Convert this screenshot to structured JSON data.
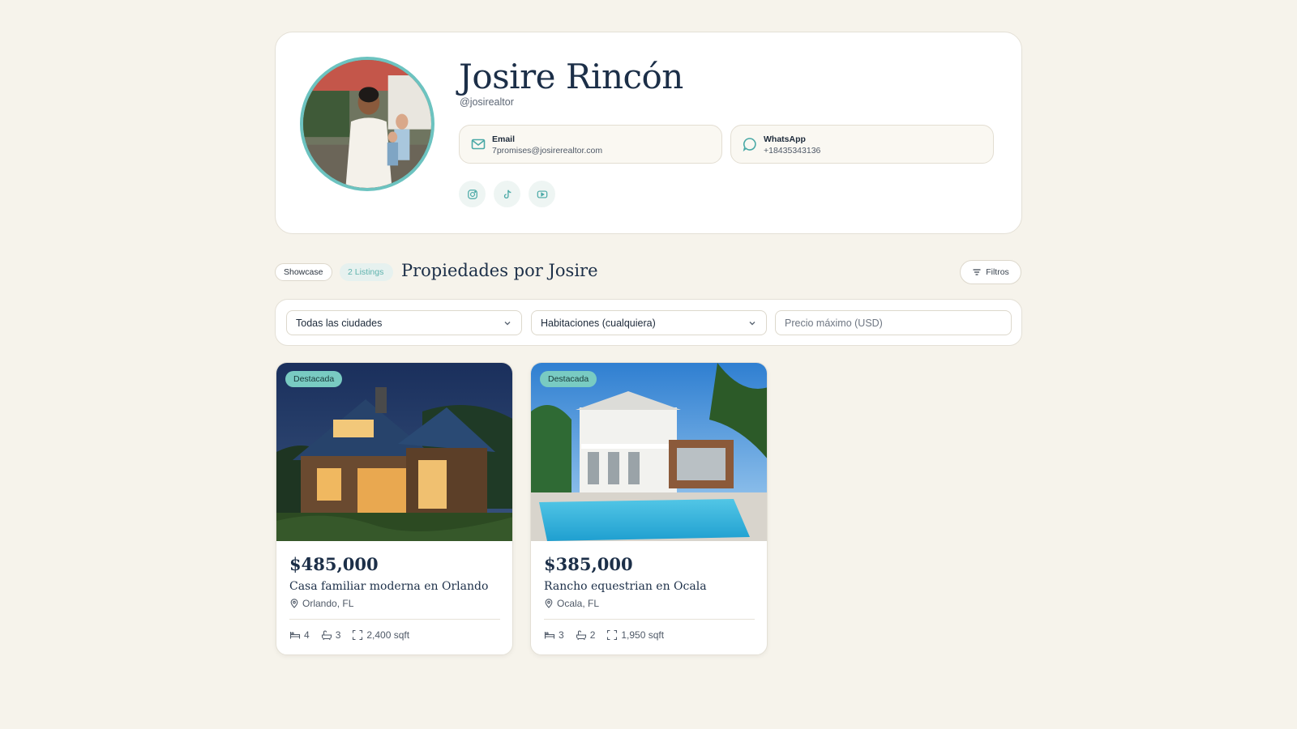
{
  "profile": {
    "name": "Josire Rincón",
    "handle": "@josirealtor",
    "contacts": [
      {
        "title": "Email",
        "value": "7promises@josirerealtor.com",
        "icon": "mail-icon"
      },
      {
        "title": "WhatsApp",
        "value": "+18435343136",
        "icon": "chat-icon"
      }
    ],
    "socials": [
      "instagram-icon",
      "tiktok-icon",
      "youtube-icon"
    ]
  },
  "section": {
    "showcase_label": "Showcase",
    "listings_count_label": "2 Listings",
    "title": "Propiedades por Josire",
    "filters_label": "Filtros"
  },
  "filters": {
    "city_selected": "Todas las ciudades",
    "bedrooms_selected": "Habitaciones (cualquiera)",
    "max_price_placeholder": "Precio máximo (USD)",
    "max_price_value": ""
  },
  "listings": [
    {
      "badge": "Destacada",
      "price": "$485,000",
      "title": "Casa familiar moderna en Orlando",
      "location": "Orlando, FL",
      "beds": "4",
      "baths": "3",
      "area": "2,400 sqft"
    },
    {
      "badge": "Destacada",
      "price": "$385,000",
      "title": "Rancho equestrian en Ocala",
      "location": "Ocala, FL",
      "beds": "3",
      "baths": "2",
      "area": "1,950 sqft"
    }
  ],
  "colors": {
    "background": "#f6f3eb",
    "accent_teal": "#6cc3c0",
    "badge": "#79cbc2",
    "navy_text": "#1c2f48"
  }
}
